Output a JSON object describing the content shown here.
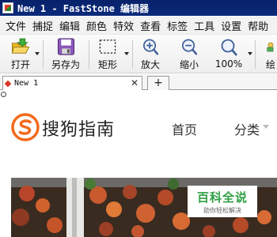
{
  "window": {
    "title": "New 1 - FastStone 编辑器",
    "app_icon": "faststone-app-icon"
  },
  "menu": {
    "items": [
      "文件",
      "捕捉",
      "编辑",
      "颜色",
      "特效",
      "查看",
      "标签",
      "工具",
      "设置",
      "帮助"
    ]
  },
  "toolbar": {
    "open_label": "打开",
    "save_as_label": "另存为",
    "rect_label": "矩形",
    "zoom_in_label": "放大",
    "zoom_out_label": "缩小",
    "zoom_label": "100%",
    "draw_label": "绘"
  },
  "tabs": {
    "active_name": "New 1",
    "close_glyph": "✕",
    "new_tab_glyph": "+"
  },
  "document": {
    "site_name": "搜狗指南",
    "nav": {
      "home": "首页",
      "category": "分类"
    },
    "badge": {
      "title": "百科全说",
      "subtitle": "助你轻松解决"
    }
  },
  "colors": {
    "titlebar": "#08216b",
    "brand_orange": "#f26a1b",
    "baike_green": "#2fa043",
    "tab_marker": "#d9331f"
  }
}
